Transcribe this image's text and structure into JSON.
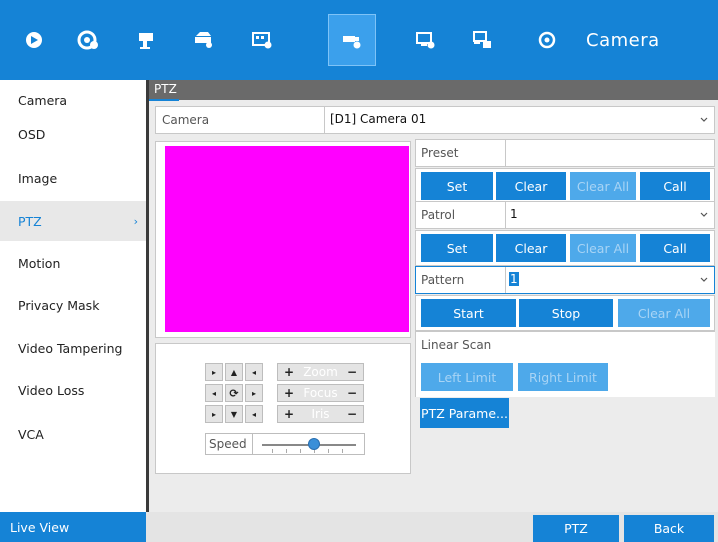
{
  "topbar": {
    "title": "Camera",
    "icons": [
      "live-view-icon",
      "playback-icon",
      "record-icon",
      "storage-icon",
      "camera-settings-icon",
      "ptz-settings-icon",
      "monitor-settings-icon",
      "network-icon",
      "maintenance-icon"
    ]
  },
  "sidebar": {
    "items": [
      {
        "label": "Camera"
      },
      {
        "label": "OSD"
      },
      {
        "label": "Image"
      },
      {
        "label": "PTZ"
      },
      {
        "label": "Motion"
      },
      {
        "label": "Privacy Mask"
      },
      {
        "label": "Video Tampering"
      },
      {
        "label": "Video Loss"
      },
      {
        "label": "VCA"
      }
    ],
    "active_chevron": "›"
  },
  "main": {
    "tab": "PTZ",
    "camera_label": "Camera",
    "camera_value": "[D1] Camera 01",
    "video_color": "#ff00ff"
  },
  "ptz_controls": {
    "zoom_label": "Zoom",
    "focus_label": "Focus",
    "iris_label": "Iris",
    "plus": "+",
    "minus": "−",
    "speed_label": "Speed",
    "speed_level": 0.55
  },
  "preset": {
    "label": "Preset",
    "value": "",
    "buttons": [
      "Set",
      "Clear",
      "Clear All",
      "Call"
    ]
  },
  "patrol": {
    "label": "Patrol",
    "value": "1",
    "buttons": [
      "Set",
      "Clear",
      "Clear All",
      "Call"
    ]
  },
  "pattern": {
    "label": "Pattern",
    "value": "1",
    "buttons": [
      "Start",
      "Stop",
      "Clear All"
    ]
  },
  "linear_scan": {
    "label": "Linear Scan",
    "buttons": [
      "Left Limit",
      "Right Limit"
    ]
  },
  "ptz_param_button": "PTZ Parame...",
  "bottom": {
    "live_view": "Live View",
    "ptz_button": "PTZ",
    "back_button": "Back"
  },
  "colors": {
    "accent": "#1583d6",
    "disabled_button": "#4ea9ea"
  }
}
